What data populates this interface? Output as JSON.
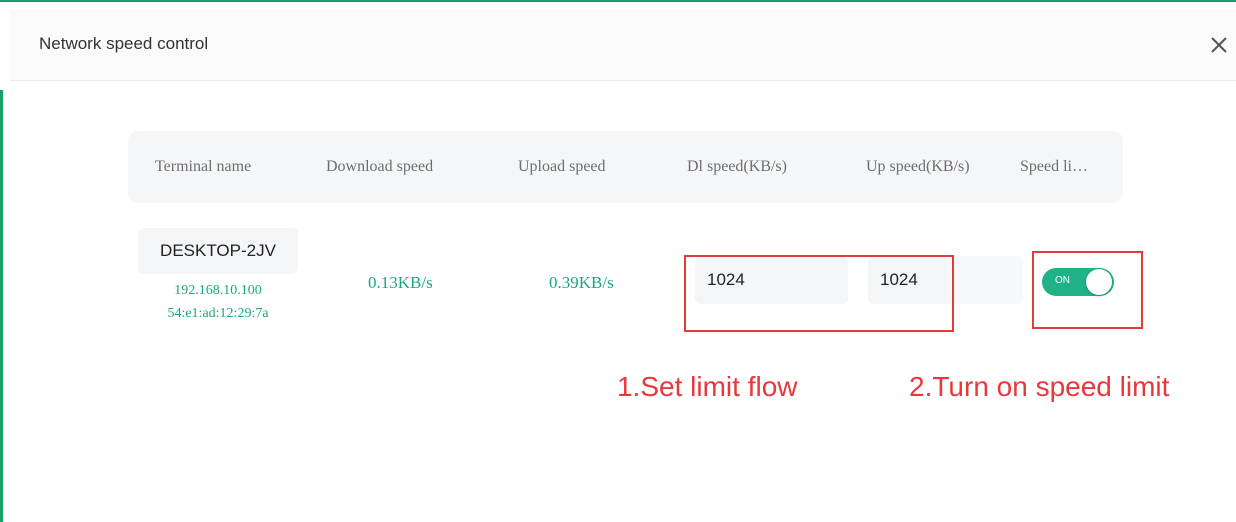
{
  "dialog": {
    "title": "Network speed control"
  },
  "table": {
    "headers": [
      "Terminal name",
      "Download speed",
      "Upload speed",
      "Dl speed(KB/s)",
      "Up speed(KB/s)",
      "Speed li…"
    ],
    "rows": [
      {
        "terminal_name": "DESKTOP-2JV",
        "ip": "192.168.10.100",
        "mac": "54:e1:ad:12:29:7a",
        "download_speed": "0.13KB/s",
        "upload_speed": "0.39KB/s",
        "dl_limit": "1024",
        "up_limit": "1024",
        "speed_limit_toggle": "ON"
      }
    ]
  },
  "annotations": {
    "step1": "1.Set limit flow",
    "step2": "2.Turn on speed limit"
  },
  "colors": {
    "accent_green": "#1aa77f",
    "toggle_on": "#20b287",
    "annotation_red": "#e8383b"
  },
  "icons": {
    "close": "close-icon"
  }
}
